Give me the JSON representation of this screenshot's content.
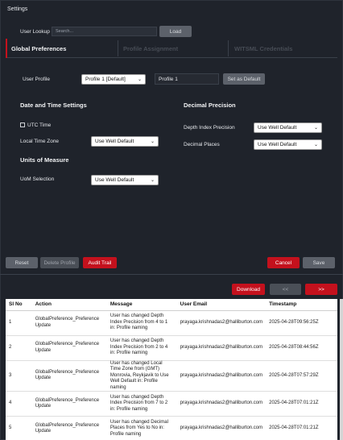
{
  "window": {
    "title": "Settings"
  },
  "lookup": {
    "label": "User Lookup",
    "placeholder": "Search...",
    "load_label": "Load"
  },
  "tabs": [
    {
      "label": "Global Preferences",
      "active": true
    },
    {
      "label": "Profile Assignment",
      "active": false
    },
    {
      "label": "WITSML Credentials",
      "active": false
    }
  ],
  "profile": {
    "label": "User Profile",
    "selected": "Profile 1 [Default]",
    "name_value": "Profile 1",
    "set_default_label": "Set as Default"
  },
  "datetime": {
    "heading": "Date and Time Settings",
    "utc_label": "UTC Time",
    "timezone_label": "Local Time Zone",
    "timezone_value": "Use Well Default"
  },
  "precision": {
    "heading": "Decimal Precision",
    "depth_label": "Depth Index Precision",
    "depth_value": "Use Well Default",
    "places_label": "Decimal Places",
    "places_value": "Use Well Default"
  },
  "uom": {
    "heading": "Units of Measure",
    "label": "UoM Selection",
    "value": "Use Well Default"
  },
  "actions": {
    "reset": "Reset",
    "delete_profile": "Delete Profile",
    "audit_trail": "Audit Trail",
    "cancel": "Cancel",
    "save": "Save"
  },
  "audit": {
    "download": "Download",
    "prev": "<<",
    "next": ">>",
    "columns": [
      "Sl No",
      "Action",
      "Message",
      "User Email",
      "Timestamp"
    ],
    "rows": [
      {
        "sl": "1",
        "action": "GlobalPreference_Preference Update",
        "message": "User has changed Depth Index Precision from 4 to 1 in: Profile naming",
        "email": "prayaga.krishnadas2@halliburton.com",
        "timestamp": "2025-04-28T09:56:25Z"
      },
      {
        "sl": "2",
        "action": "GlobalPreference_Preference Update",
        "message": "User has changed Depth Index Precision from 2 to 4 in: Profile naming",
        "email": "prayaga.krishnadas2@halliburton.com",
        "timestamp": "2025-04-28T08:44:56Z"
      },
      {
        "sl": "3",
        "action": "GlobalPreference_Preference Update",
        "message": "User has changed Local Time Zone from (GMT) Monrovia, Reykjavik to Use Well Default in: Profile naming",
        "email": "prayaga.krishnadas2@halliburton.com",
        "timestamp": "2025-04-28T07:57:29Z"
      },
      {
        "sl": "4",
        "action": "GlobalPreference_Preference Update",
        "message": "User has changed Depth Index Precision from 7 to 2 in: Profile naming",
        "email": "prayaga.krishnadas2@halliburton.com",
        "timestamp": "2025-04-28T07:01:21Z"
      },
      {
        "sl": "5",
        "action": "GlobalPreference_Preference Update",
        "message": "User has changed Decimal Places from Yes to No in: Profile naming",
        "email": "prayaga.krishnadas2@halliburton.com",
        "timestamp": "2025-04-28T07:01:21Z"
      }
    ]
  }
}
